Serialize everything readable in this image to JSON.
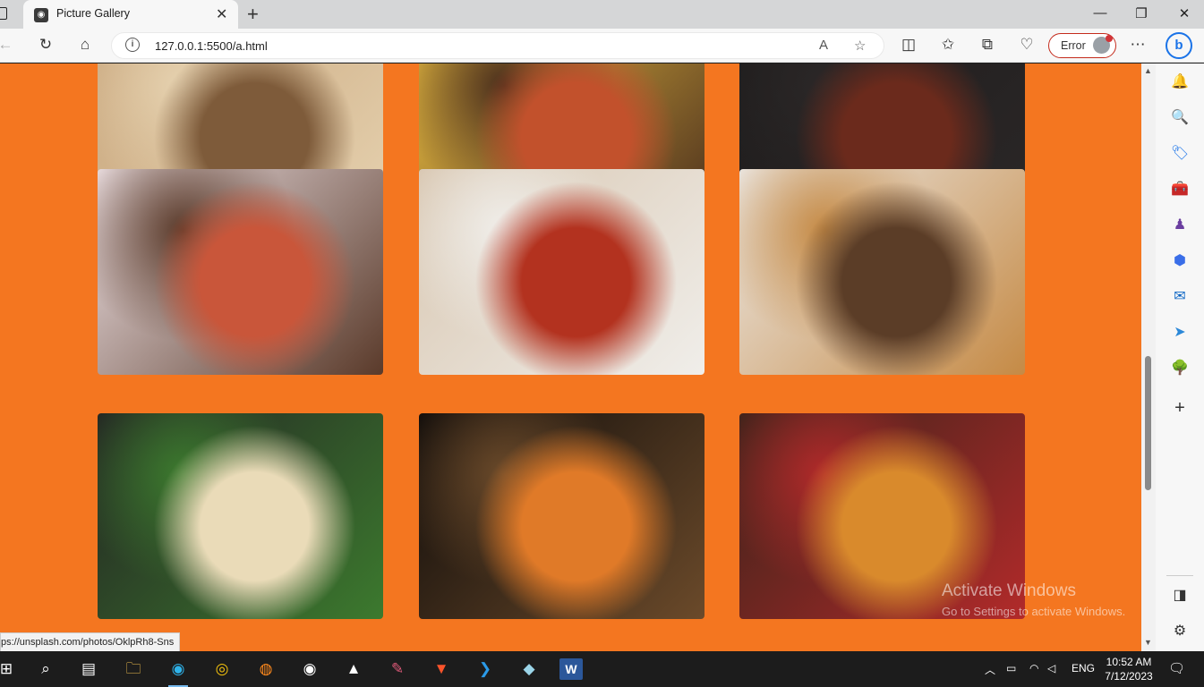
{
  "browser": {
    "tab_title": "Picture Gallery",
    "tab_close": "✕",
    "new_tab": "+",
    "url": "127.0.0.1:5500/a.html",
    "error_label": "Error",
    "minimize": "—",
    "restore": "❐",
    "close": "✕"
  },
  "gallery": {
    "photos": [
      {
        "alt": "pizza on wooden board",
        "colors": [
          "#c7a47a",
          "#7e5b3a",
          "#e6d2b0"
        ]
      },
      {
        "alt": "cheese pull pepperoni pizza",
        "colors": [
          "#f1c443",
          "#c2512c",
          "#4a2e1c"
        ]
      },
      {
        "alt": "pizza on dark board",
        "colors": [
          "#1e1c1c",
          "#6b2a1c",
          "#2b2727"
        ]
      },
      {
        "alt": "pepperoni slice on paper",
        "colors": [
          "#efe3e6",
          "#c9563a",
          "#5a3a2a"
        ]
      },
      {
        "alt": "pepperoni slices in box",
        "colors": [
          "#d8c6b0",
          "#b3321f",
          "#f0eeea"
        ]
      },
      {
        "alt": "pizza with coca cola on board",
        "colors": [
          "#ece9e6",
          "#5b3d27",
          "#c58a45"
        ]
      },
      {
        "alt": "margherita on dark stone",
        "colors": [
          "#232323",
          "#eadbb8",
          "#3c7a2e"
        ]
      },
      {
        "alt": "pizza in wood oven",
        "colors": [
          "#0e0b0a",
          "#e07a28",
          "#6b4a2a"
        ]
      },
      {
        "alt": "large pepperoni pizza",
        "colors": [
          "#3a231a",
          "#d98a2c",
          "#b22a2a"
        ]
      }
    ]
  },
  "status_url": "ps://unsplash.com/photos/OklpRh8-Sns",
  "watermark": {
    "title": "Activate Windows",
    "subtitle": "Go to Settings to activate Windows."
  },
  "taskbar": {
    "lang": "ENG",
    "time": "10:52 AM",
    "date": "7/12/2023"
  }
}
